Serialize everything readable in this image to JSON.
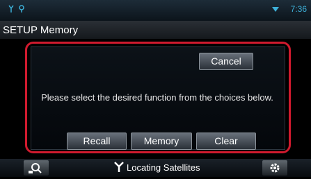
{
  "screen": {
    "title": "SETUP Memory"
  },
  "status": {
    "time": "7:36"
  },
  "dialog": {
    "cancel_label": "Cancel",
    "message": "Please select the desired function from the choices below.",
    "buttons": [
      "Recall",
      "Memory",
      "Clear"
    ]
  },
  "bottom": {
    "status_text": "Locating Satellites"
  },
  "icons": {
    "status_left": "antenna-icon",
    "status_right": "wifi-icon",
    "bottom_left": "search-icon",
    "bottom_center": "satellite-antenna-icon",
    "bottom_right": "gear-icon"
  },
  "colors": {
    "highlight": "#d01a2e",
    "status": "#3db0d8"
  }
}
